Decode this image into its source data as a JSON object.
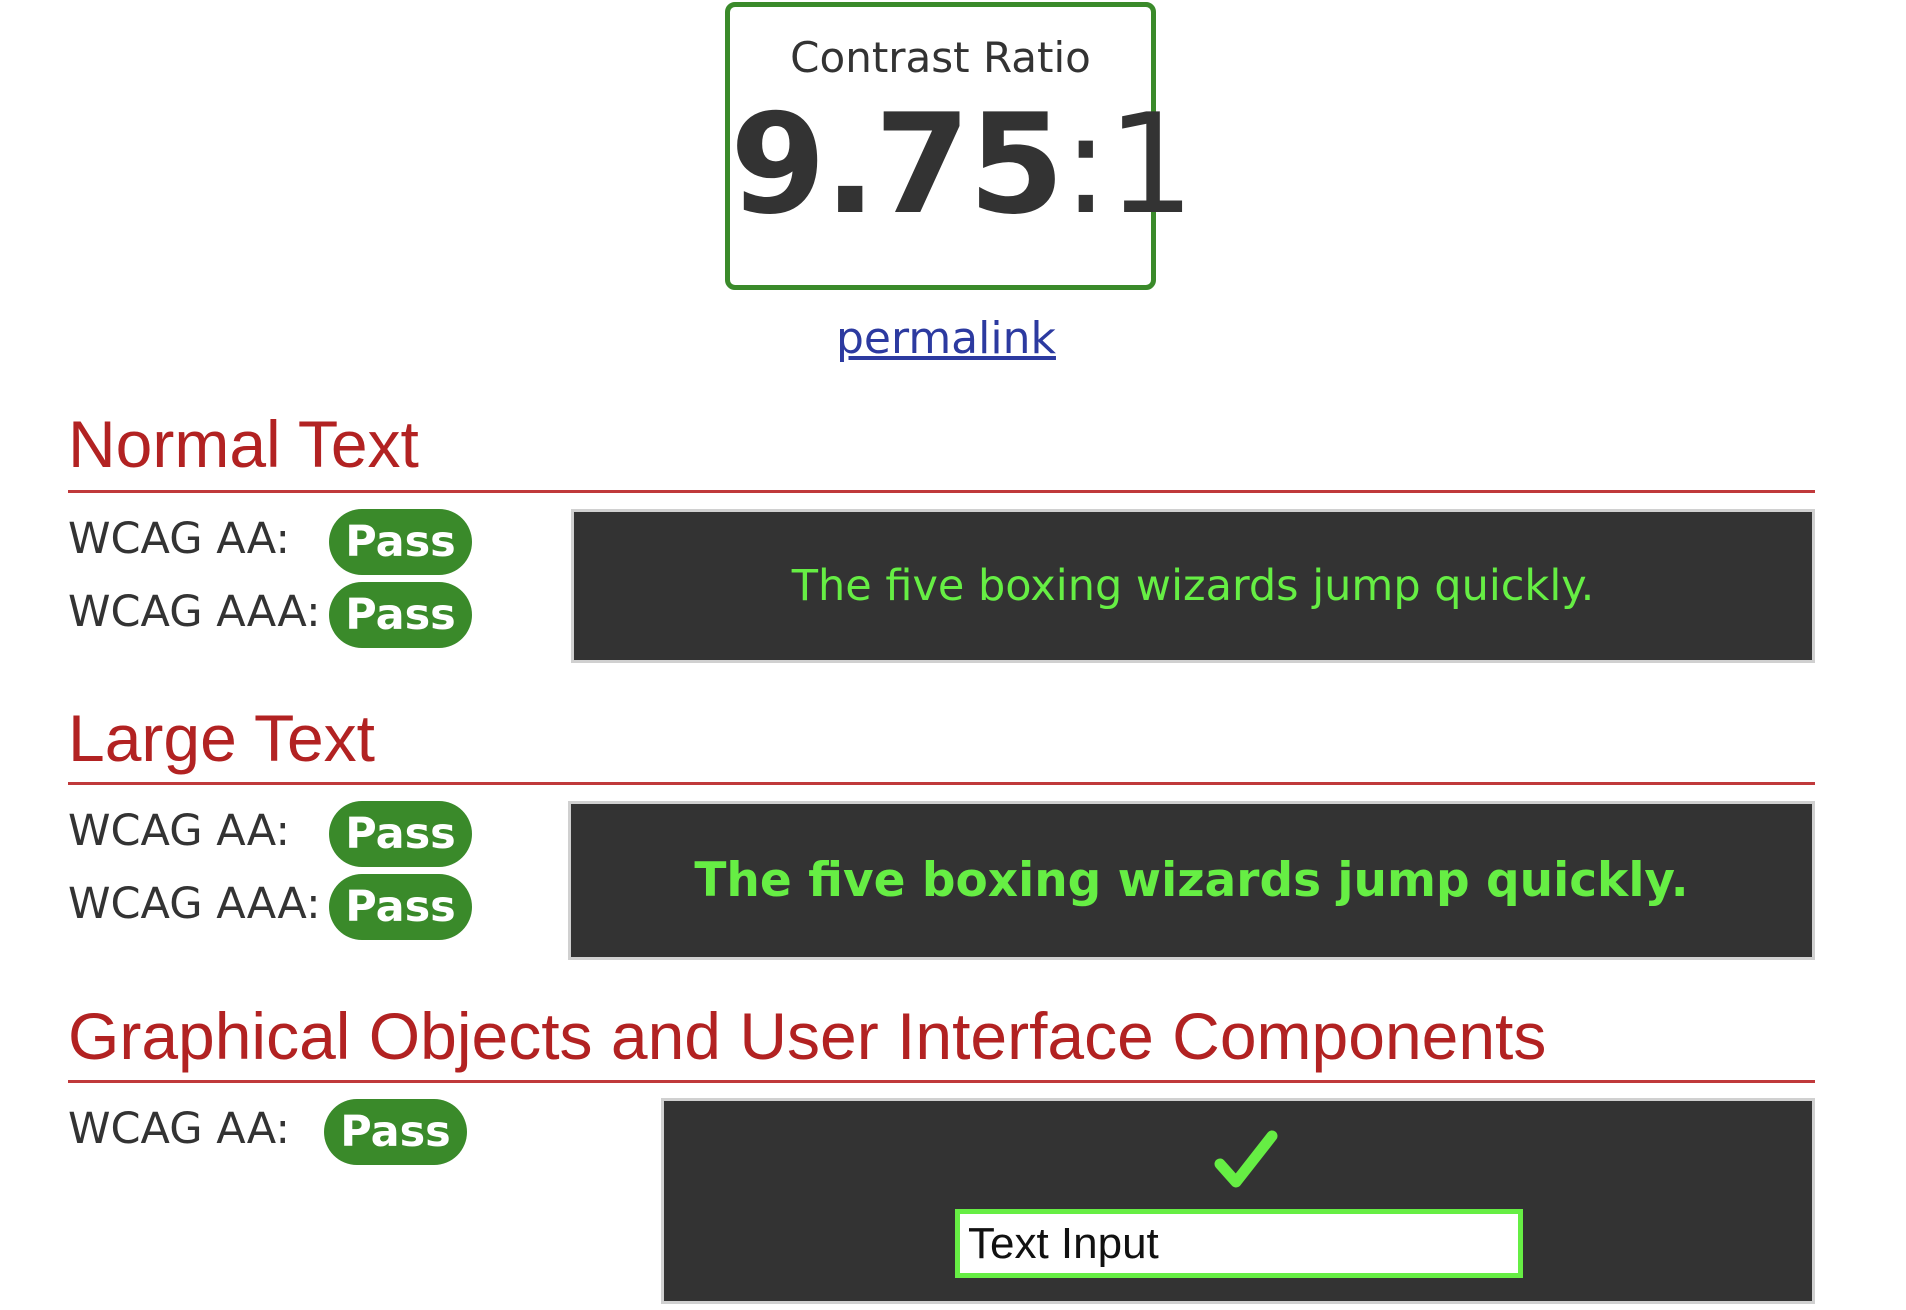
{
  "contrast": {
    "title": "Contrast Ratio",
    "ratio_main": "9.75",
    "ratio_suffix": ":1",
    "permalink_label": "permalink"
  },
  "sections": {
    "normal": {
      "title": "Normal Text",
      "aa_label": "WCAG AA:",
      "aa_result": "Pass",
      "aaa_label": "WCAG AAA:",
      "aaa_result": "Pass",
      "sample_text": "The five boxing wizards jump quickly."
    },
    "large": {
      "title": "Large Text",
      "aa_label": "WCAG AA:",
      "aa_result": "Pass",
      "aaa_label": "WCAG AAA:",
      "aaa_result": "Pass",
      "sample_text": "The five boxing wizards jump quickly."
    },
    "graphical": {
      "title": "Graphical Objects and User Interface Components",
      "aa_label": "WCAG AA:",
      "aa_result": "Pass",
      "check_icon": "checkmark-icon",
      "input_value": "Text Input"
    }
  },
  "colors": {
    "foreground": "#66ee44",
    "background": "#333333",
    "pass_badge": "#3a8a2a",
    "heading": "#b22222",
    "link": "#2c3aa0"
  }
}
